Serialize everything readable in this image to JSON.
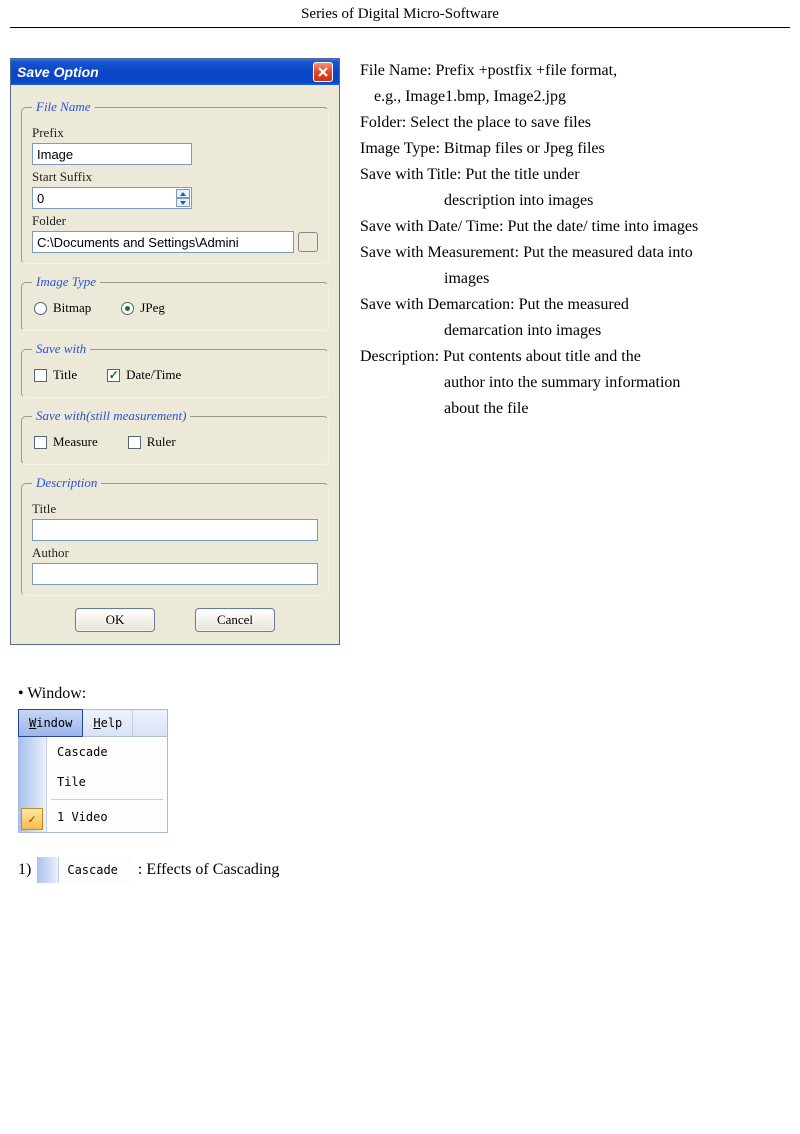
{
  "header": "Series of Digital Micro-Software",
  "dialog": {
    "title": "Save Option",
    "filename_group": "File Name",
    "prefix_label": "Prefix",
    "prefix_value": "Image",
    "suffix_label": "Start Suffix",
    "suffix_value": "0",
    "folder_label": "Folder",
    "folder_value": "C:\\Documents and Settings\\Admini",
    "imagetype_group": "Image Type",
    "bitmap_label": "Bitmap",
    "jpeg_label": "JPeg",
    "savewith_group": "Save with",
    "title_chk": "Title",
    "datetime_chk": "Date/Time",
    "savewith_still_group": "Save with(still measurement)",
    "measure_chk": "Measure",
    "ruler_chk": "Ruler",
    "description_group": "Description",
    "desc_title_label": "Title",
    "desc_author_label": "Author",
    "ok": "OK",
    "cancel": "Cancel"
  },
  "explain": {
    "l1": "File Name: Prefix +postfix +file format,",
    "l2": "e.g., Image1.bmp, Image2.jpg",
    "l3": "Folder: Select the place to save files",
    "l4": "Image Type: Bitmap files or Jpeg files",
    "l5": "Save with Title: Put the title under",
    "l6": "description into images",
    "l7": "Save with Date/ Time: Put the date/ time into images",
    "l8": "Save with Measurement: Put the measured data into",
    "l9": "images",
    "l10": "Save with Demarcation: Put the measured",
    "l11": "demarcation into images",
    "l12": "Description: Put contents about title and the",
    "l13": "author into the summary information",
    "l14": "about the file"
  },
  "lower": {
    "bullet": "• Window:",
    "window_menu": "Window",
    "help_menu": "Help",
    "cascade": "Cascade",
    "tile": "Tile",
    "video": "1 Video",
    "num1": "1)",
    "cascade_effects": ": Effects of Cascading"
  }
}
